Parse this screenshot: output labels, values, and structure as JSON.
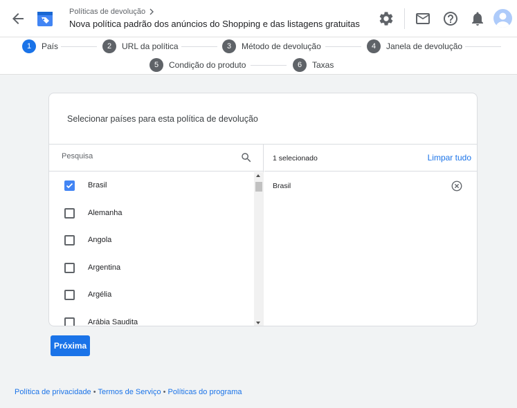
{
  "header": {
    "breadcrumb": "Políticas de devolução",
    "title": "Nova política padrão dos anúncios do Shopping e das listagens gratuitas"
  },
  "stepper": {
    "steps": [
      {
        "num": "1",
        "label": "País"
      },
      {
        "num": "2",
        "label": "URL da política"
      },
      {
        "num": "3",
        "label": "Método de devolução"
      },
      {
        "num": "4",
        "label": "Janela de devolução"
      },
      {
        "num": "5",
        "label": "Condição do produto"
      },
      {
        "num": "6",
        "label": "Taxas"
      }
    ]
  },
  "card": {
    "title": "Selecionar países para esta política de devolução",
    "search_placeholder": "Pesquisa",
    "countries": [
      {
        "name": "Brasil",
        "checked": true
      },
      {
        "name": "Alemanha",
        "checked": false
      },
      {
        "name": "Angola",
        "checked": false
      },
      {
        "name": "Argentina",
        "checked": false
      },
      {
        "name": "Argélia",
        "checked": false
      },
      {
        "name": "Arábia Saudita",
        "checked": false
      }
    ],
    "selected_count": "1 selecionado",
    "clear_all": "Limpar tudo",
    "selected": [
      "Brasil"
    ]
  },
  "actions": {
    "next": "Próxima"
  },
  "footer": {
    "privacy": "Política de privacidade",
    "terms": "Termos de Serviço",
    "program": "Políticas do programa",
    "separator": "•"
  },
  "colors": {
    "accent": "#1a73e8",
    "checkbox_checked": "#4285f4",
    "step_inactive": "#5f6368"
  }
}
